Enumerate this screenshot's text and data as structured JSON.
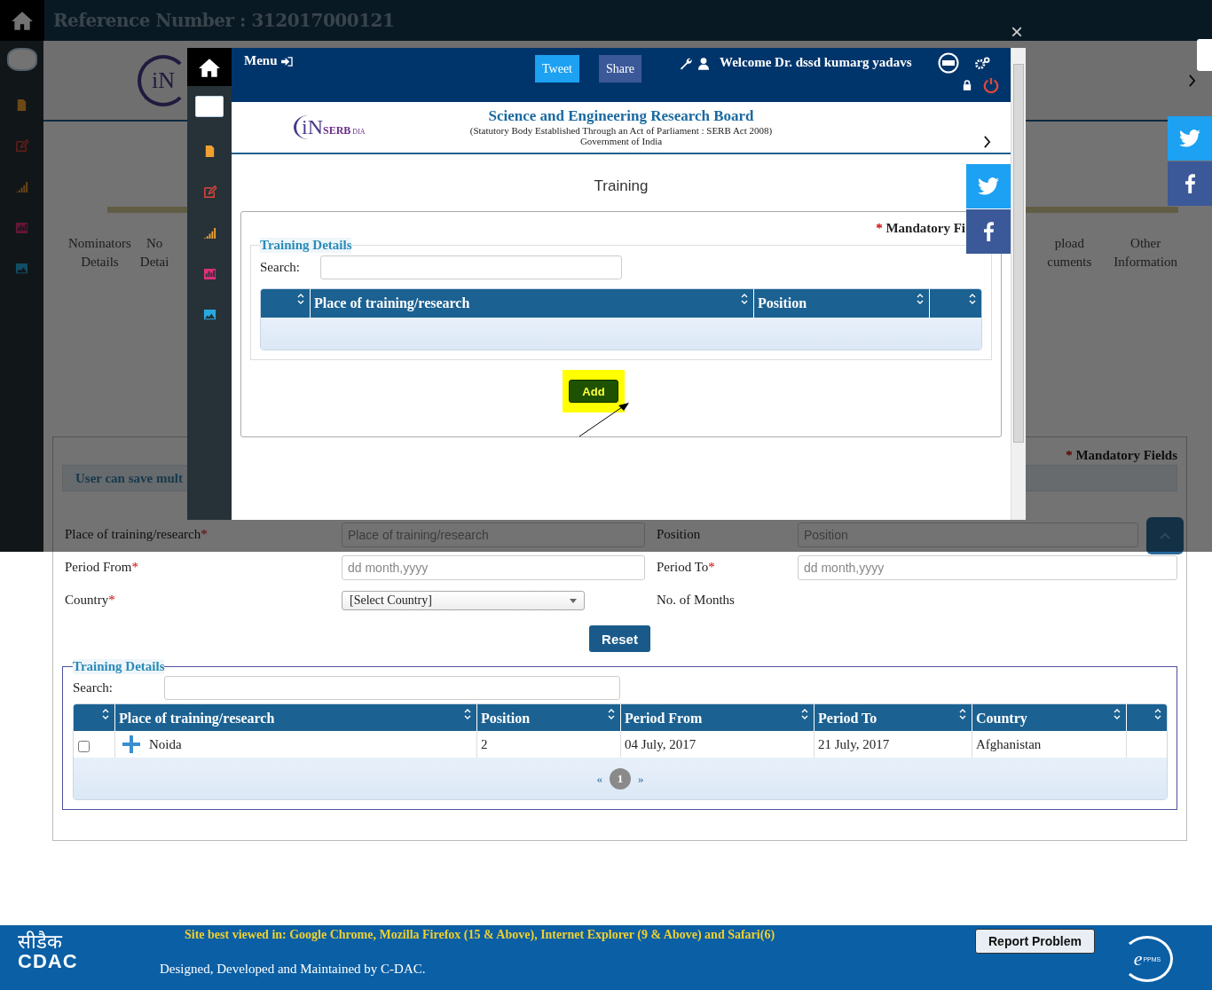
{
  "header": {
    "reference": "Reference Number : 312017000121"
  },
  "background": {
    "logo_mark": "iN"
  },
  "steps": [
    {
      "line1": "Nominators",
      "line2": "Details"
    },
    {
      "line1": "No",
      "line2": "Detai"
    },
    {
      "line1": "pload",
      "line2": "cuments"
    },
    {
      "line1": "Other",
      "line2": "Information"
    }
  ],
  "form": {
    "mandatory_mark": "*",
    "mandatory_note": "Mandatory Fields",
    "info": "User can save mult",
    "rows": [
      [
        {
          "label": "Place of training/research",
          "required": true,
          "kind": "text",
          "placeholder": "Place of training/research"
        },
        {
          "label": "Position",
          "required": false,
          "kind": "text",
          "placeholder": "Position"
        }
      ],
      [
        {
          "label": "Period From",
          "required": true,
          "kind": "text",
          "placeholder": "dd month,yyyy"
        },
        {
          "label": "Period To",
          "required": true,
          "kind": "text",
          "placeholder": "dd month,yyyy"
        }
      ],
      [
        {
          "label": "Country",
          "required": true,
          "kind": "select",
          "value": "[Select Country]"
        },
        {
          "label": "No. of Months",
          "required": false,
          "kind": "none"
        }
      ]
    ],
    "reset": "Reset"
  },
  "table": {
    "legend": "Training Details",
    "search_label": "Search:",
    "columns": [
      "Place of training/research",
      "Position",
      "Period From",
      "Period To",
      "Country"
    ],
    "rows": [
      {
        "checked": false,
        "cells": [
          "Noida",
          "2",
          "04 July, 2017",
          "21 July, 2017",
          "Afghanistan"
        ]
      }
    ],
    "prev": "«",
    "pages": [
      {
        "label": "1",
        "selected": true
      }
    ],
    "next": "»"
  },
  "modal": {
    "close": "×",
    "menu": "Menu",
    "tweet": "Tweet",
    "share": "Share",
    "welcome": "Welcome Dr. dssd kumarg yadavs",
    "logo": {
      "mark": "iN",
      "name": "SERB",
      "sub": "DIA"
    },
    "org_title": "Science and Engineering Research Board",
    "org_sub": "(Statutory Body Established Through an Act of Parliament : SERB Act 2008)",
    "org_gov": "Government of India",
    "page_title": "Training",
    "mandatory_mark": "*",
    "mandatory_note": "Mandatory Fi",
    "legend": "Training Details",
    "search_label": "Search:",
    "columns": [
      "Place of training/research",
      "Position"
    ],
    "add": "Add"
  },
  "footer": {
    "logo_hindi": "सीडैक",
    "logo_latin": "CDAC",
    "browsers": "Site best viewed in: Google Chrome, Mozilla Firefox (15 & Above), Internet Explorer (9 & Above) and Safari(6)",
    "credit": "Designed, Developed and Maintained by C-DAC.",
    "report": "Report Problem",
    "eppms_e": "e",
    "eppms_sub": "PPMS"
  }
}
